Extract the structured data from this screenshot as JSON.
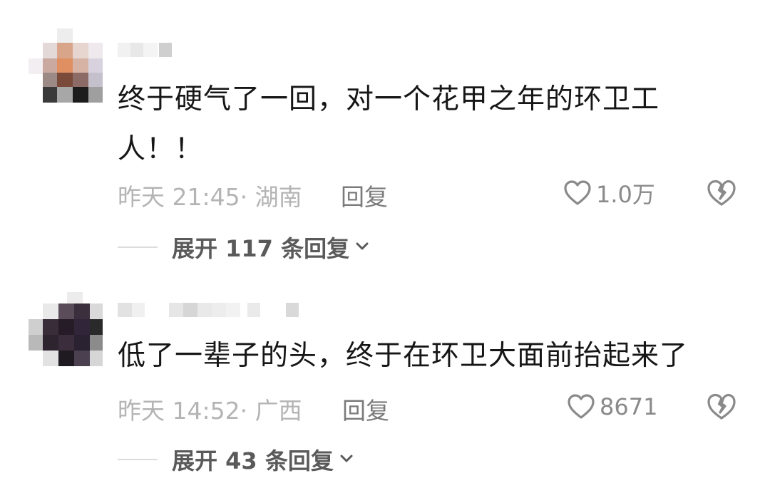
{
  "comments": [
    {
      "text": "终于硬气了一回，对一个花甲之年的环卫工人！！",
      "time": "昨天 21:45",
      "location": "湖南",
      "meta": "昨天 21:45· 湖南",
      "reply_label": "回复",
      "likes": "1.0万",
      "expand_label": "展开 117 条回复"
    },
    {
      "text": "低了一辈子的头，终于在环卫大面前抬起来了",
      "time": "昨天 14:52",
      "location": "广西",
      "meta": "昨天 14:52· 广西",
      "reply_label": "回复",
      "likes": "8671",
      "expand_label": "展开 43 条回复"
    }
  ],
  "icons": {
    "like": "heart-outline-icon",
    "dislike": "broken-heart-icon",
    "expand": "chevron-down-icon"
  },
  "colors": {
    "text": "#161616",
    "meta": "#b4b4b4",
    "action": "#7a7a7a",
    "expand": "#5a5a5a",
    "icon": "#8a8a8a"
  }
}
